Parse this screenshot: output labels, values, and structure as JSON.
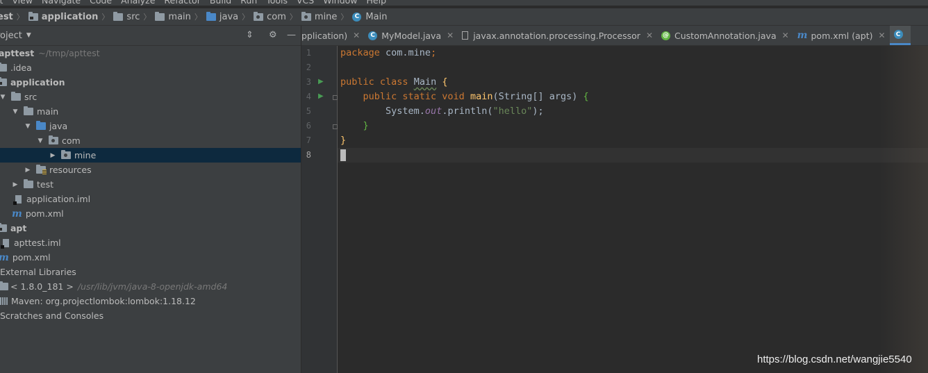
{
  "menu": [
    "it",
    "View",
    "Navigate",
    "Code",
    "Analyze",
    "Refactor",
    "Build",
    "Run",
    "Tools",
    "VCS",
    "Window",
    "Help"
  ],
  "breadcrumbs": [
    {
      "label": "est",
      "icon": "none"
    },
    {
      "label": "application",
      "icon": "module-folder-icon"
    },
    {
      "label": "src",
      "icon": "folder-icon"
    },
    {
      "label": "main",
      "icon": "folder-icon"
    },
    {
      "label": "java",
      "icon": "source-folder-icon"
    },
    {
      "label": "com",
      "icon": "package-icon"
    },
    {
      "label": "mine",
      "icon": "package-icon"
    },
    {
      "label": "Main",
      "icon": "class-icon"
    }
  ],
  "project": {
    "title": "roject",
    "tree": {
      "root_label": "apttest",
      "root_path": "~/tmp/apttest",
      "idea": ".idea",
      "application": "application",
      "src": "src",
      "main": "main",
      "java": "java",
      "com": "com",
      "mine": "mine",
      "resources": "resources",
      "test": "test",
      "application_iml": "application.iml",
      "pom1": "pom.xml",
      "apt": "apt",
      "apttest_iml": "apttest.iml",
      "pom2": "pom.xml",
      "external": "External Libraries",
      "jdk": "< 1.8.0_181 >",
      "jdk_path": "/usr/lib/jvm/java-8-openjdk-amd64",
      "maven": "Maven: org.projectlombok:lombok:1.18.12",
      "scratches": "Scratches and Consoles"
    }
  },
  "tabs": [
    {
      "label": "pplication)",
      "icon": "none"
    },
    {
      "label": "MyModel.java",
      "icon": "class-icon"
    },
    {
      "label": "javax.annotation.processing.Processor",
      "icon": "file-icon"
    },
    {
      "label": "CustomAnnotation.java",
      "icon": "annotation-icon"
    },
    {
      "label": "pom.xml (apt)",
      "icon": "maven-icon"
    }
  ],
  "code": {
    "line_numbers": [
      "1",
      "2",
      "3",
      "4",
      "5",
      "6",
      "7",
      "8"
    ],
    "l1_kw": "package",
    "l1_rest": " com.mine",
    "l1_semi": ";",
    "l3_kw": "public class",
    "l3_name": "Main",
    "l3_brace": " {",
    "l4_indent": "    ",
    "l4_kw": "public static void",
    "l4_fn": "main",
    "l4_args": "(String[] args) ",
    "l4_brace": "{",
    "l5_pre": "        System.",
    "l5_field": "out",
    "l5_call": ".println(",
    "l5_str": "\"hello\"",
    "l5_end": ");",
    "l6": "    }",
    "l7": "}"
  },
  "watermark": "https://blog.csdn.net/wangjie5540"
}
